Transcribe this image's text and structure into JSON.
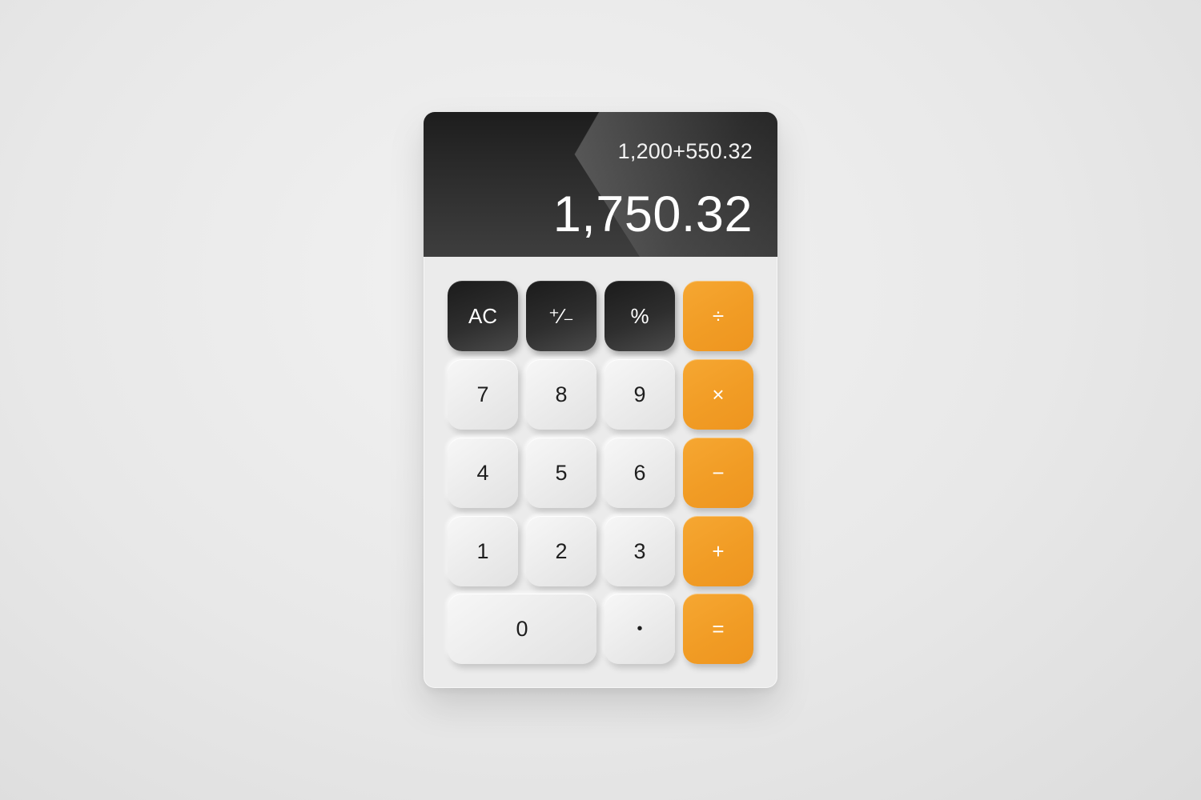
{
  "display": {
    "expression": "1,200+550.32",
    "result": "1,750.32"
  },
  "keys": {
    "ac": "AC",
    "sign": "⁺∕₋",
    "percent": "%",
    "divide": "÷",
    "seven": "7",
    "eight": "8",
    "nine": "9",
    "multiply": "×",
    "four": "4",
    "five": "5",
    "six": "6",
    "minus": "−",
    "one": "1",
    "two": "2",
    "three": "3",
    "plus": "+",
    "zero": "0",
    "decimal": "•",
    "equals": "="
  },
  "colors": {
    "operator": "#f19c25",
    "function": "#2a2a2a",
    "number": "#ececec",
    "display": "#2a2a2a"
  }
}
